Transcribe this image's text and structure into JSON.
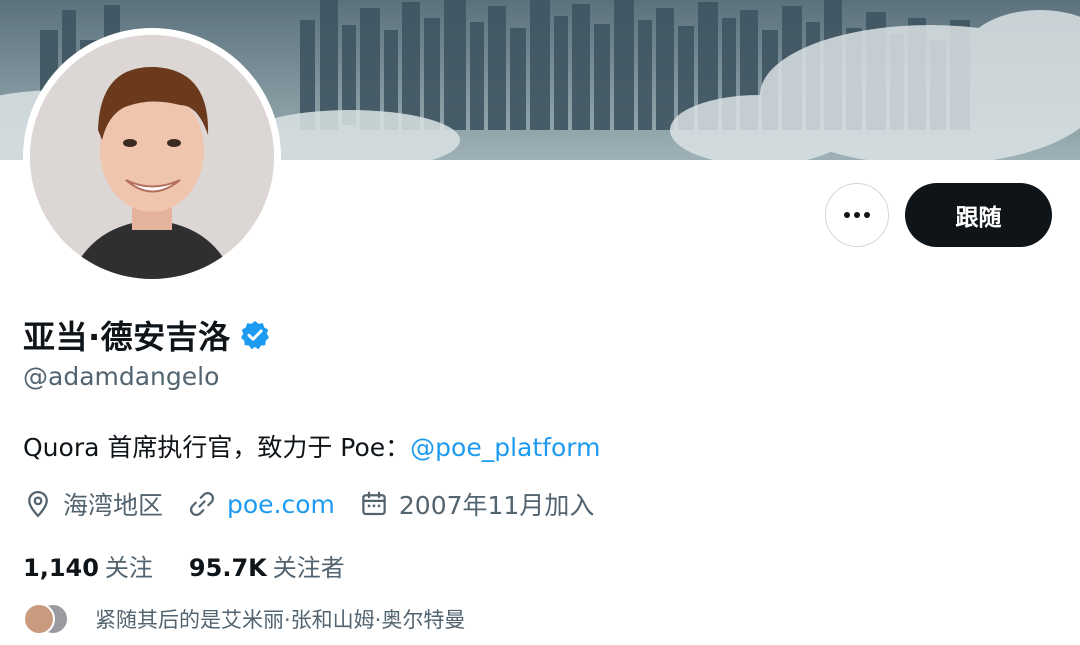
{
  "profile": {
    "name": "亚当·德安吉洛",
    "handle": "@adamdangelo",
    "bio_text": "Quora 首席执行官，致力于 Poe：",
    "bio_mention": "@poe_platform",
    "location": "海湾地区",
    "website": "poe.com",
    "joined": "2007年11月加入",
    "following_count": "1,140",
    "following_label": "关注",
    "followers_count": "95.7K",
    "followers_label": "关注者",
    "followed_by": "紧随其后的是艾米丽·张和山姆·奥尔特曼"
  },
  "actions": {
    "follow_label": "跟随"
  },
  "icons": {
    "more": "more-horizontal-icon",
    "verified": "verified-badge-icon",
    "location": "location-pin-icon",
    "link": "link-icon",
    "calendar": "calendar-icon"
  },
  "colors": {
    "accent": "#1d9bf0",
    "primary_text": "#0f1419",
    "secondary_text": "#536471",
    "button_dark": "#0f1419"
  }
}
